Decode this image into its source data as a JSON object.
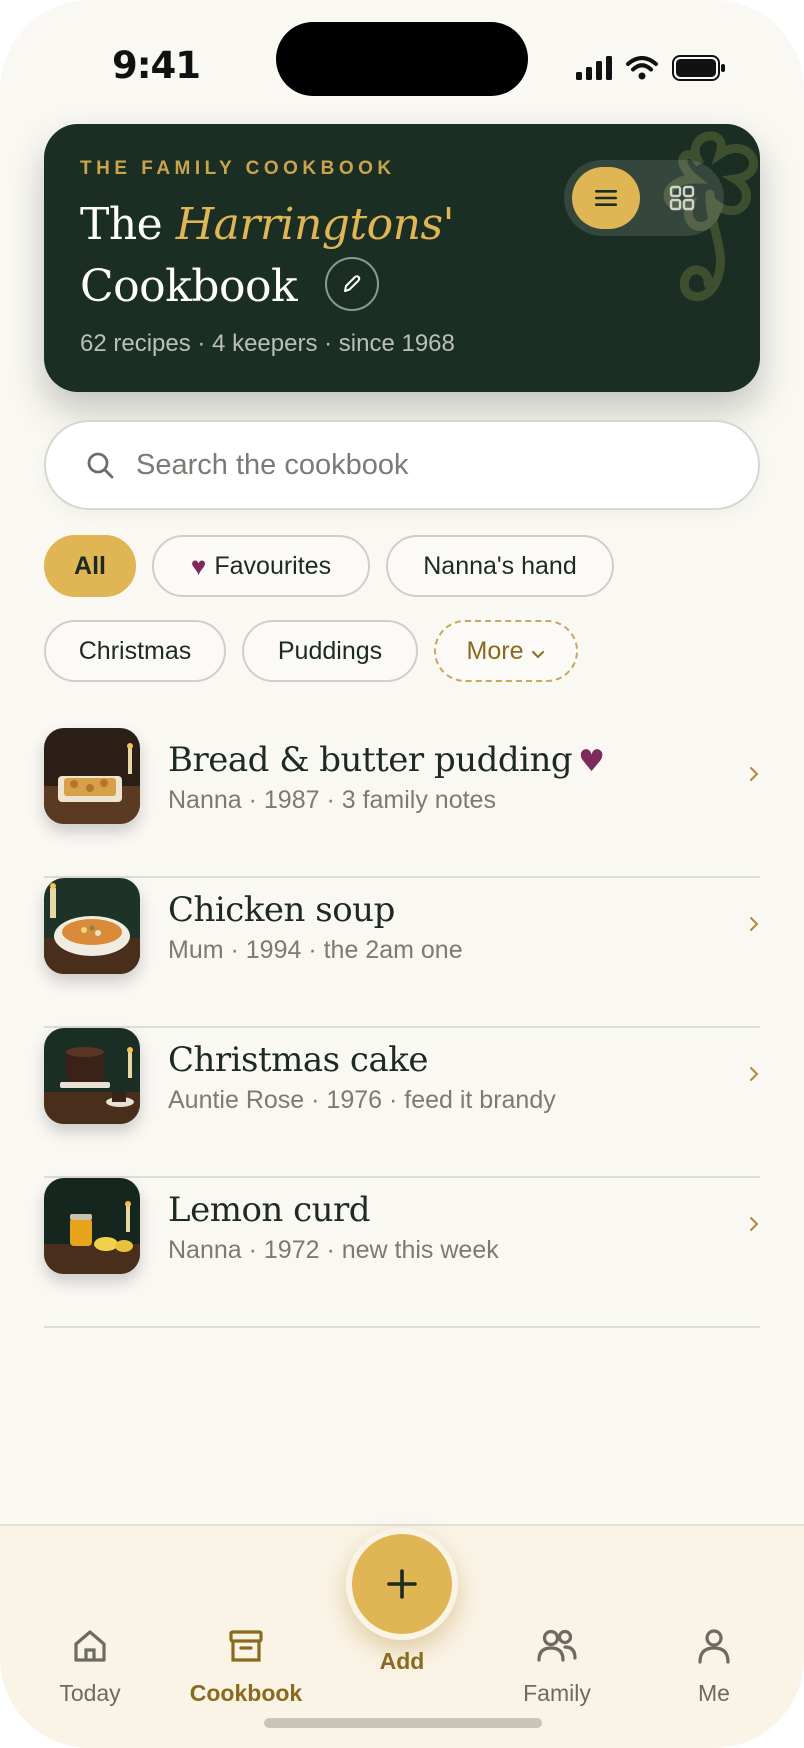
{
  "status": {
    "time": "9:41"
  },
  "hero": {
    "kicker": "THE FAMILY COOKBOOK",
    "title_pre": "The ",
    "title_accent": "Harringtons'",
    "title_line2": "Cookbook",
    "meta": "62 recipes · 4 keepers · since 1968"
  },
  "search": {
    "placeholder": "Search the cookbook"
  },
  "filters": [
    {
      "label": "All",
      "active": true
    },
    {
      "label": "Favourites",
      "icon": "heart-icon"
    },
    {
      "label": "Nanna's hand"
    },
    {
      "label": "Christmas"
    },
    {
      "label": "Puddings"
    },
    {
      "label": "More",
      "icon": "chevron-down-icon"
    }
  ],
  "recipes": [
    {
      "title": "Bread & butter pudding",
      "favourite": true,
      "subtitle": "Nanna · 1987 · 3 family notes"
    },
    {
      "title": "Chicken soup",
      "favourite": false,
      "subtitle": "Mum · 1994 · the 2am one"
    },
    {
      "title": "Christmas cake",
      "favourite": false,
      "subtitle": "Auntie Rose · 1976 · feed it brandy"
    },
    {
      "title": "Lemon curd",
      "favourite": false,
      "subtitle": "Nanna · 1972 · new this week"
    }
  ],
  "tabbar": {
    "today": "Today",
    "cookbook": "Cookbook",
    "add": "Add",
    "family": "Family",
    "me": "Me",
    "active": "cookbook"
  },
  "colors": {
    "accent": "#e0b554",
    "hero_bg": "#1a2e23",
    "favourite": "#7c2b5a",
    "background": "#faf8f3"
  }
}
